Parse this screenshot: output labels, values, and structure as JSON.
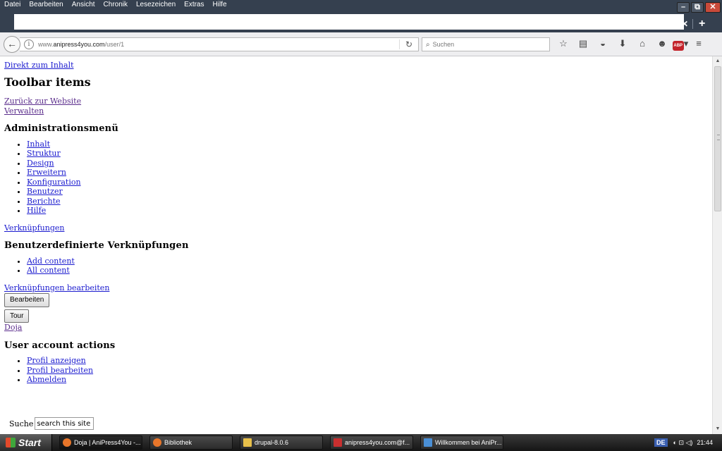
{
  "window": {
    "menu": [
      "Datei",
      "Bearbeiten",
      "Ansicht",
      "Chronik",
      "Lesezeichen",
      "Extras",
      "Hilfe"
    ],
    "controls": {
      "minimize": "–",
      "maximize": "⧉",
      "close": "✕"
    },
    "tab_close": "✕",
    "tab_new": "+"
  },
  "navbar": {
    "url_prefix": "www.",
    "url_domain": "anipress4you.com",
    "url_path": "/user/1",
    "search_placeholder": "Suchen"
  },
  "page": {
    "skip_link": "Direkt zum Inhalt",
    "toolbar_heading": "Toolbar items",
    "back_link": "Zurück zur Website",
    "manage_link": "Verwalten",
    "admin_heading": "Administrationsmenü",
    "admin_items": [
      "Inhalt",
      "Struktur",
      "Design",
      "Erweitern",
      "Konfiguration",
      "Benutzer",
      "Berichte",
      "Hilfe"
    ],
    "shortcuts_link": "Verknüpfungen",
    "custom_heading": "Benutzerdefinierte Verknüpfungen",
    "custom_items": [
      "Add content",
      "All content"
    ],
    "edit_shortcuts_link": "Verknüpfungen bearbeiten",
    "edit_button": "Bearbeiten",
    "tour_button": "Tour",
    "user_link": "Doja",
    "account_heading": "User account actions",
    "account_items": [
      "Profil anzeigen",
      "Profil bearbeiten",
      "Abmelden"
    ],
    "search_label": "Suche",
    "search_value": "search this site"
  },
  "taskbar": {
    "start": "Start",
    "tasks": [
      {
        "label": "Doja | AniPress4You -...",
        "color": "#e8762a"
      },
      {
        "label": "Bibliothek",
        "color": "#e8762a"
      },
      {
        "label": "drupal-8.0.6",
        "color": "#e8c04a"
      },
      {
        "label": "anipress4you.com@f...",
        "color": "#c92f2f"
      },
      {
        "label": "Willkommen bei AniPr...",
        "color": "#4a8fd6"
      }
    ],
    "lang": "DE",
    "tray_icons": "◐ ⊡ ◁)",
    "clock": "21:44"
  }
}
